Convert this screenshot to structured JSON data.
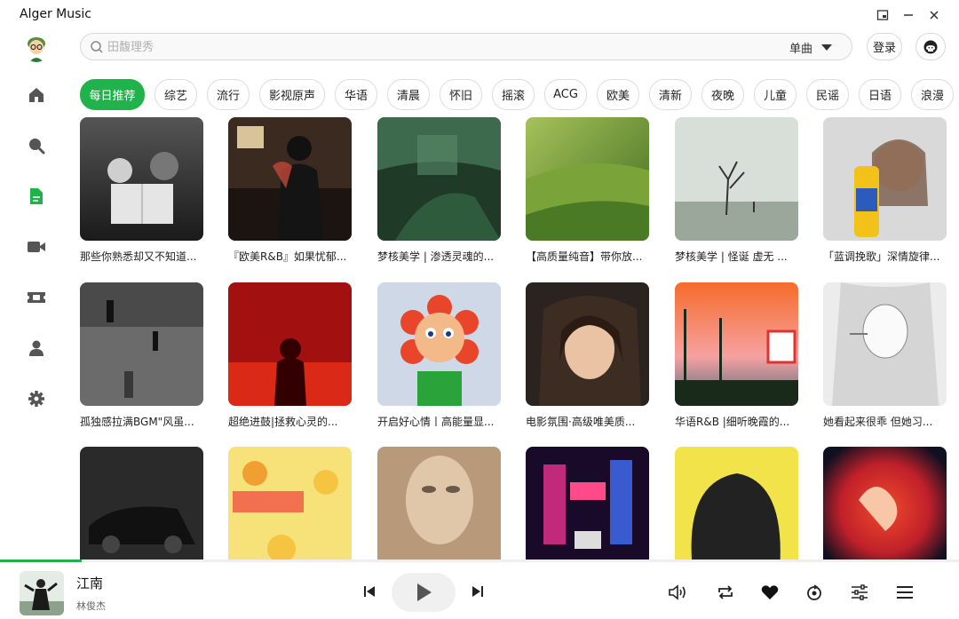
{
  "app": {
    "title": "Alger Music"
  },
  "window_controls": [
    "restore-icon",
    "minimize-icon",
    "close-icon"
  ],
  "sidebar": {
    "items": [
      {
        "name": "home",
        "icon": "home-icon",
        "active": false
      },
      {
        "name": "search",
        "icon": "search-icon",
        "active": false
      },
      {
        "name": "list",
        "icon": "document-icon",
        "active": true
      },
      {
        "name": "mv",
        "icon": "video-icon",
        "active": false
      },
      {
        "name": "history",
        "icon": "ticket-icon",
        "active": false
      },
      {
        "name": "user",
        "icon": "user-icon",
        "active": false
      },
      {
        "name": "settings",
        "icon": "gear-icon",
        "active": false
      }
    ]
  },
  "header": {
    "search_placeholder": "田馥理秀",
    "search_type": "单曲",
    "login_label": "登录",
    "github_icon": "github-icon"
  },
  "tags": [
    "每日推荐",
    "综艺",
    "流行",
    "影视原声",
    "华语",
    "清晨",
    "怀旧",
    "摇滚",
    "ACG",
    "欧美",
    "清新",
    "夜晚",
    "儿童",
    "民谣",
    "日语",
    "浪漫"
  ],
  "active_tag": "每日推荐",
  "playlists": [
    {
      "title": "那些你熟悉却又不知道..."
    },
    {
      "title": "『欧美R&B』如果忧郁..."
    },
    {
      "title": "梦核美学 | 渗透灵魂的..."
    },
    {
      "title": "【高质量纯音】带你放..."
    },
    {
      "title": "梦核美学 | 怪诞 虚无 ..."
    },
    {
      "title": "「蓝调挽歌」深情旋律..."
    },
    {
      "title": "孤独感拉满BGM\"风虽..."
    },
    {
      "title": "超绝进鼓|拯救心灵的..."
    },
    {
      "title": "开启好心情丨高能量显..."
    },
    {
      "title": "电影氛围·高级唯美质..."
    },
    {
      "title": "华语R&B |细听晚霞的..."
    },
    {
      "title": "她看起来很乖 但她习..."
    },
    {
      "title": ""
    },
    {
      "title": ""
    },
    {
      "title": ""
    },
    {
      "title": ""
    },
    {
      "title": ""
    },
    {
      "title": ""
    }
  ],
  "player": {
    "song_name": "江南",
    "artist": "林俊杰",
    "progress": 0.085,
    "controls": [
      "prev-icon",
      "play-icon",
      "next-icon",
      "volume-icon",
      "repeat-icon",
      "heart-icon",
      "rewind-icon",
      "equalizer-icon",
      "playlist-icon"
    ]
  },
  "colors": {
    "accent": "#22b24c"
  }
}
